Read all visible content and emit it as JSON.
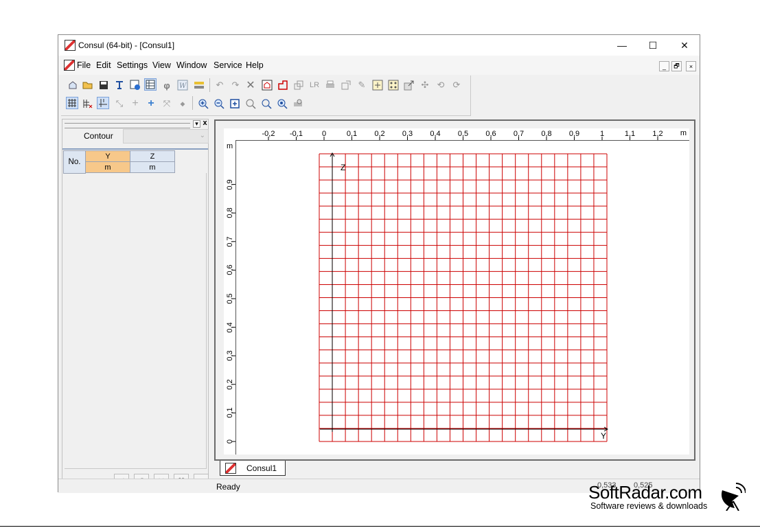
{
  "window": {
    "title": "Consul (64-bit) - [Consul1]",
    "minimize": "—",
    "maximize": "☐",
    "close": "✕"
  },
  "menu": {
    "items": [
      "File",
      "Edit",
      "Settings",
      "View",
      "Window",
      "Service",
      "Help"
    ],
    "mdi_minimize": "_",
    "mdi_restore": "🗗",
    "mdi_close": "×"
  },
  "toolbar": {
    "row1_icons": [
      "new-icon",
      "open-folder-icon",
      "save-icon",
      "section-icon",
      "settings-icon",
      "table-icon",
      "phi-icon",
      "word-icon",
      "panel-icon",
      "undo-icon",
      "redo-icon",
      "delete-icon",
      "house-icon",
      "contour-icon",
      "copy-icon",
      "lr-icon",
      "print-icon",
      "export-icon",
      "pen-icon",
      "fit-icon",
      "grid-fit-icon",
      "arrow-icon",
      "cross-icon",
      "rotate-icon",
      "refresh-icon"
    ],
    "row2_icons": [
      "grid-icon",
      "snap-icon",
      "axes-icon",
      "line-icon",
      "plus-icon",
      "move-icon",
      "node-icon",
      "point-icon",
      "zoom-in-icon",
      "zoom-out-icon",
      "zoom-window-icon",
      "zoom-all-icon",
      "zoom-previous-icon",
      "zoom-extents-icon",
      "print-preview-icon"
    ]
  },
  "left_panel": {
    "contour_label": "Contour",
    "contour_value": "",
    "table": {
      "col_no": "No.",
      "col_y": "Y",
      "col_z": "Z",
      "unit_y": "m",
      "unit_z": "m"
    },
    "close_x": "x",
    "pin": "▾",
    "buttons": [
      "check-icon",
      "undo-icon",
      "delete-icon",
      "wand-icon",
      "n-icon"
    ]
  },
  "drawing": {
    "x_unit": "m",
    "y_unit": "m",
    "x_ticks": [
      "-0,2",
      "-0,1",
      "0",
      "0,1",
      "0,2",
      "0,3",
      "0,4",
      "0,5",
      "0,6",
      "0,7",
      "0,8",
      "0,9",
      "1",
      "1,1",
      "1,2"
    ],
    "y_ticks": [
      "0",
      "0,1",
      "0,2",
      "0,3",
      "0,4",
      "0,5",
      "0,6",
      "0,7",
      "0,8",
      "0,9"
    ],
    "axis_y_label": "Y",
    "axis_z_label": "Z",
    "grid_color": "#cc0000",
    "grid_cols": 22,
    "grid_rows": 22,
    "tab_label": "Consul1"
  },
  "status": {
    "text": "Ready",
    "coord1": "0,533",
    "coord2": "0,525"
  },
  "watermark": {
    "brand": "SoftRadar.com",
    "tagline": "Software reviews & downloads"
  }
}
